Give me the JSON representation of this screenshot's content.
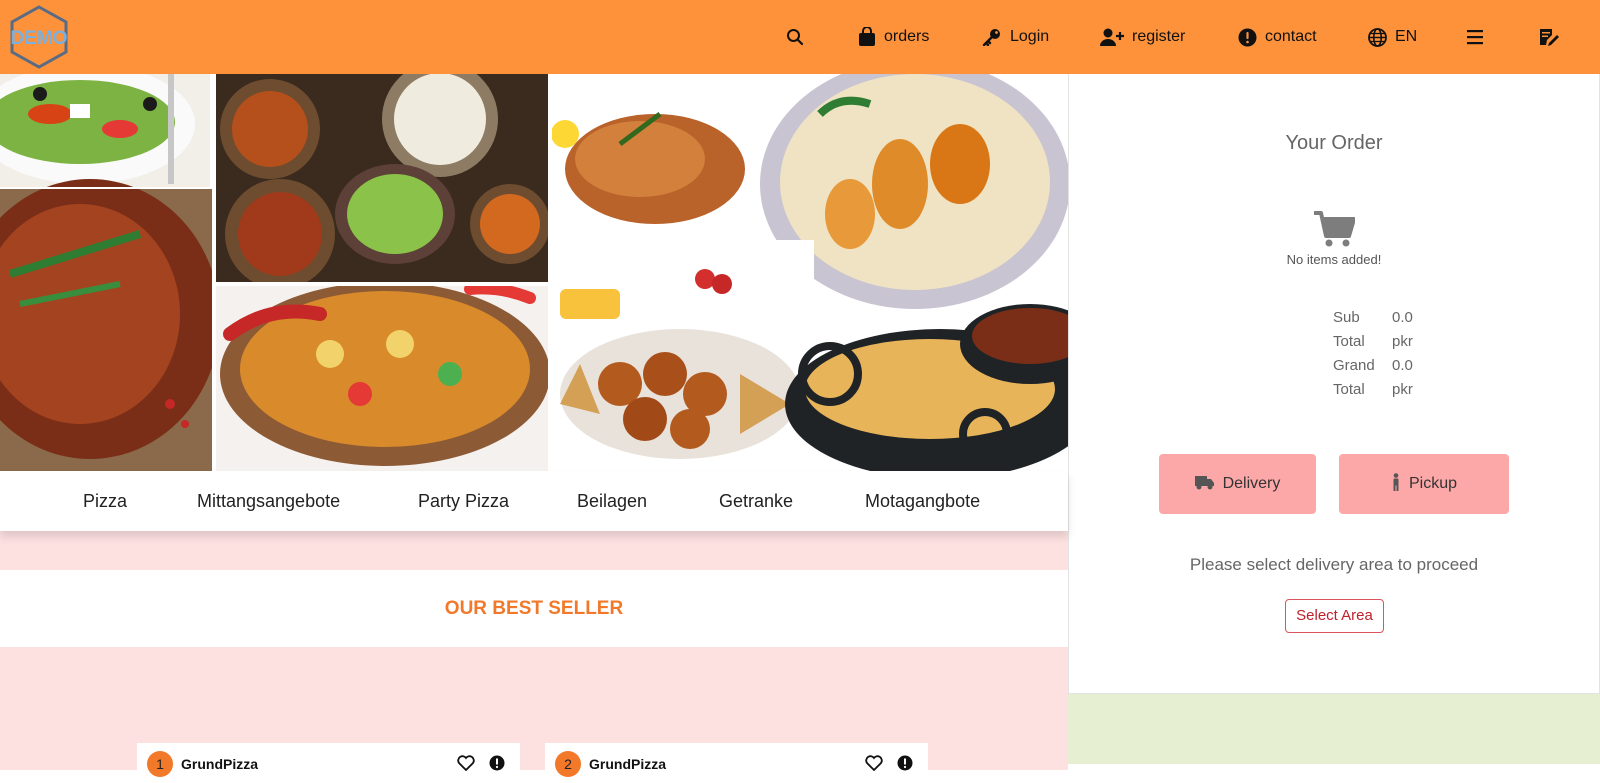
{
  "header": {
    "logo_text": "DEMO",
    "nav": {
      "orders": "orders",
      "login": "Login",
      "register": "register",
      "contact": "contact",
      "language": "EN"
    }
  },
  "categories": [
    "Pizza",
    "Mittangsangebote",
    "Party Pizza",
    "Beilagen",
    "Getranke",
    "Motagangbote"
  ],
  "bestseller": {
    "title": "OUR BEST SELLER",
    "items": [
      {
        "rank": "1",
        "name": "GrundPizza"
      },
      {
        "rank": "2",
        "name": "GrundPizza"
      }
    ]
  },
  "order": {
    "title": "Your Order",
    "empty_text": "No items added!",
    "sub_total_label_1": "Sub",
    "sub_total_label_2": "Total",
    "sub_total_value": "0.0",
    "sub_total_currency": "pkr",
    "grand_total_label_1": "Grand",
    "grand_total_label_2": "Total",
    "grand_total_value": "0.0",
    "grand_total_currency": "pkr",
    "delivery_label": "Delivery",
    "pickup_label": "Pickup",
    "prompt": "Please select delivery area to proceed",
    "select_area_label": "Select Area"
  },
  "colors": {
    "header": "#fd923b",
    "accent": "#f2782a",
    "pink_bg": "#fde1e1",
    "button_pink": "#fda8a8",
    "select_area": "#c0212b",
    "green_box": "#e7efd3"
  }
}
